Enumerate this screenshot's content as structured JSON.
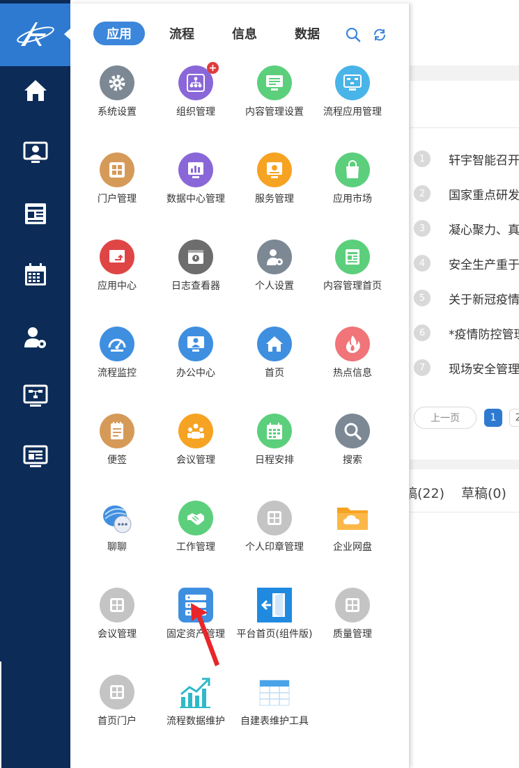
{
  "colors": {
    "sidebar": "#0c2b57",
    "logo_bg": "#2e7ad0",
    "tab_active": "#3c86db",
    "gray": "#7c8894",
    "purple": "#8a67d8",
    "green": "#5ccf7c",
    "cyan": "#49b4e8",
    "tan": "#d69a58",
    "orange": "#f6a323",
    "red": "#e04545",
    "darkgray": "#6d6d6d",
    "blue": "#3f8fe0",
    "pink": "#f07478",
    "lightgray": "#c4c4c4",
    "arrow": "#e8262a"
  },
  "sidebar": {
    "logo": "logo-mark",
    "items": [
      {
        "name": "home",
        "icon": "home-icon"
      },
      {
        "name": "office",
        "icon": "monitor-user-icon"
      },
      {
        "name": "news",
        "icon": "newspaper-icon"
      },
      {
        "name": "calendar",
        "icon": "calendar-icon"
      },
      {
        "name": "user-settings",
        "icon": "user-gear-icon"
      },
      {
        "name": "flow-monitor",
        "icon": "flow-monitor-icon"
      },
      {
        "name": "content",
        "icon": "content-monitor-icon"
      }
    ]
  },
  "panel": {
    "tabs": [
      {
        "label": "应用",
        "active": true
      },
      {
        "label": "流程",
        "active": false
      },
      {
        "label": "信息",
        "active": false
      },
      {
        "label": "数据",
        "active": false
      }
    ],
    "tools": [
      {
        "icon": "search-icon"
      },
      {
        "icon": "refresh-icon"
      }
    ],
    "apps": [
      {
        "label": "系统设置",
        "icon": "gear-icon",
        "color": "#7c8894"
      },
      {
        "label": "组织管理",
        "icon": "org-chart-icon",
        "color": "#8a67d8",
        "badge": "+"
      },
      {
        "label": "内容管理设置",
        "icon": "monitor-content-icon",
        "color": "#5ccf7c"
      },
      {
        "label": "流程应用管理",
        "icon": "flow-app-icon",
        "color": "#49b4e8"
      },
      {
        "label": "门户管理",
        "icon": "portal-icon",
        "color": "#d69a58"
      },
      {
        "label": "数据中心管理",
        "icon": "data-center-icon",
        "color": "#8a67d8"
      },
      {
        "label": "服务管理",
        "icon": "service-icon",
        "color": "#f6a323"
      },
      {
        "label": "应用市场",
        "icon": "shopping-bag-icon",
        "color": "#5ccf7c"
      },
      {
        "label": "应用中心",
        "icon": "app-center-icon",
        "color": "#e04545"
      },
      {
        "label": "日志查看器",
        "icon": "log-viewer-icon",
        "color": "#6d6d6d"
      },
      {
        "label": "个人设置",
        "icon": "user-gear-icon",
        "color": "#7c8894"
      },
      {
        "label": "内容管理首页",
        "icon": "newspaper-icon",
        "color": "#5ccf7c"
      },
      {
        "label": "流程监控",
        "icon": "speedometer-icon",
        "color": "#3f8fe0"
      },
      {
        "label": "办公中心",
        "icon": "monitor-user-icon",
        "color": "#3f8fe0"
      },
      {
        "label": "首页",
        "icon": "home-icon",
        "color": "#3f8fe0"
      },
      {
        "label": "热点信息",
        "icon": "flame-icon",
        "color": "#f07478"
      },
      {
        "label": "便签",
        "icon": "notepad-icon",
        "color": "#d69a58"
      },
      {
        "label": "会议管理",
        "icon": "meeting-icon",
        "color": "#f6a323"
      },
      {
        "label": "日程安排",
        "icon": "calendar-icon",
        "color": "#5ccf7c"
      },
      {
        "label": "搜索",
        "icon": "search-icon",
        "color": "#7c8894"
      },
      {
        "label": "聊聊",
        "icon": "chat-bubble-icon",
        "color": "#3f8fe0"
      },
      {
        "label": "工作管理",
        "icon": "handshake-icon",
        "color": "#5ccf7c"
      },
      {
        "label": "个人印章管理",
        "icon": "grid-app-icon",
        "color": "#c4c4c4"
      },
      {
        "label": "企业网盘",
        "icon": "cloud-folder-icon",
        "color": "#f6a323"
      },
      {
        "label": "会议管理",
        "icon": "grid-app-icon",
        "color": "#c4c4c4"
      },
      {
        "label": "固定资产管理",
        "icon": "asset-server-icon",
        "color": "#3f8fe0"
      },
      {
        "label": "平台首页(组件版)",
        "icon": "exit-door-icon",
        "color": "#1f8ae0"
      },
      {
        "label": "质量管理",
        "icon": "grid-app-icon",
        "color": "#c4c4c4"
      },
      {
        "label": "首页门户",
        "icon": "grid-app-icon",
        "color": "#c4c4c4"
      },
      {
        "label": "流程数据维护",
        "icon": "trend-chart-icon",
        "color": "#2fb8c9"
      },
      {
        "label": "自建表维护工具",
        "icon": "table-icon",
        "color": "#4aa3e6"
      }
    ]
  },
  "background": {
    "news": [
      {
        "num": "1",
        "title": "轩宇智能召开"
      },
      {
        "num": "2",
        "title": "国家重点研发"
      },
      {
        "num": "3",
        "title": "凝心聚力、真"
      },
      {
        "num": "4",
        "title": "安全生产重于"
      },
      {
        "num": "5",
        "title": "关于新冠疫情"
      },
      {
        "num": "6",
        "title": "*疫情防控管理"
      },
      {
        "num": "7",
        "title": "现场安全管理"
      }
    ],
    "pagination": {
      "prev": "上一页",
      "current": "1",
      "next": "2"
    },
    "tabs": [
      {
        "label": "稿(22)"
      },
      {
        "label": "草稿(0)"
      }
    ]
  },
  "annotation": {
    "icon": "red-arrow-pointer-icon"
  }
}
